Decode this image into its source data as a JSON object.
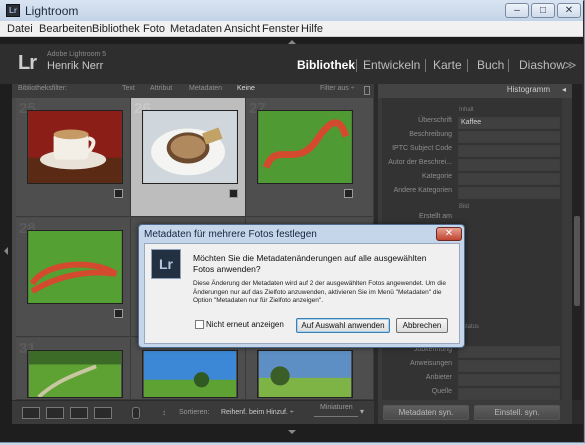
{
  "window": {
    "title": "Lightroom",
    "minimize": "–",
    "maximize": "□",
    "close": "✕"
  },
  "menu": [
    "Datei",
    "Bearbeiten",
    "Bibliothek",
    "Foto",
    "Metadaten",
    "Ansicht",
    "Fenster",
    "Hilfe"
  ],
  "identity": {
    "logo": "Lr",
    "version": "Adobe Lightroom 5",
    "user": "Henrik Nerr"
  },
  "modules": [
    "Bibliothek",
    "Entwickeln",
    "Karte",
    "Buch",
    "Diashow"
  ],
  "modules_more": "≫",
  "filter": {
    "label": "Bibliotheksfilter:",
    "tabs": [
      "Text",
      "Attribut",
      "Metadaten",
      "Keine"
    ],
    "preset": "Filter aus ÷"
  },
  "grid": {
    "numbers": [
      "25",
      "26",
      "27",
      "28",
      "",
      "",
      "31",
      "",
      ""
    ]
  },
  "toolbar": {
    "sort_label": "Sortieren:",
    "sort_value": "Reihenf. beim Hinzuf. ÷",
    "thumbs_label": "Miniaturen"
  },
  "right_panel": {
    "histogram": "Histogramm",
    "section_content": "Inhalt",
    "rows": [
      {
        "label": "Überschrift",
        "value": "Kaffee"
      },
      {
        "label": "Beschreibung",
        "value": ""
      },
      {
        "label": "IPTC Subject Code",
        "value": ""
      },
      {
        "label": "Autor der Beschrei...",
        "value": ""
      },
      {
        "label": "Kategorie",
        "value": ""
      },
      {
        "label": "Andere Kategorien",
        "value": ""
      }
    ],
    "section_image": "Bild",
    "row_created": "Erstellt am",
    "section_status": "Status",
    "rows2": [
      "Jobkennung",
      "Anweisungen",
      "Anbieter",
      "Quelle"
    ],
    "btn_sync_meta": "Metadaten syn.",
    "btn_sync_settings": "Einstell. syn."
  },
  "dialog": {
    "title": "Metadaten für mehrere Fotos festlegen",
    "close": "✕",
    "icon": "Lr",
    "message": "Möchten Sie die Metadatenänderungen auf alle ausgewählten Fotos anwenden?",
    "detail": "Diese Änderung der Metadaten wird auf 2 der ausgewählten Fotos angewendet. Um die Änderungen nur auf das Zielfoto anzuwenden, aktivieren Sie im Menü \"Metadaten\" die Option \"Metadaten nur für Zielfoto anzeigen\".",
    "checkbox_label": "Nicht erneut anzeigen",
    "checked": false,
    "btn_apply": "Auf Auswahl anwenden",
    "btn_cancel": "Abbrechen"
  }
}
